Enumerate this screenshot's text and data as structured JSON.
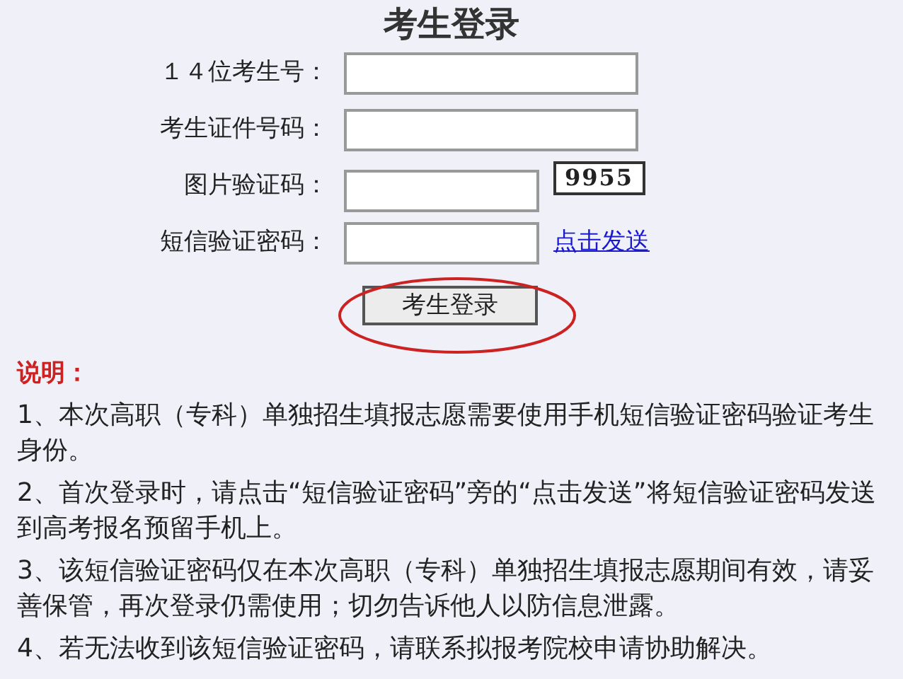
{
  "title": "考生登录",
  "fields": [
    {
      "label": "１４位考生号：",
      "kind": "wide"
    },
    {
      "label": "考生证件号码：",
      "kind": "wide"
    },
    {
      "label": "图片验证码：",
      "kind": "captcha",
      "captcha": "9955"
    },
    {
      "label": "短信验证密码：",
      "kind": "sms",
      "link": "点击发送"
    }
  ],
  "login_button": "考生登录",
  "notes": {
    "heading": "说明：",
    "items": [
      "1、本次高职（专科）单独招生填报志愿需要使用手机短信验证密码验证考生身份。",
      "2、首次登录时，请点击“短信验证密码”旁的“点击发送”将短信验证密码发送到高考报名预留手机上。",
      "3、该短信验证密码仅在本次高职（专科）单独招生填报志愿期间有效，请妥善保管，再次登录仍需使用；切勿告诉他人以防信息泄露。",
      "4、若无法收到该短信验证密码，请联系拟报考院校申请协助解决。"
    ]
  }
}
